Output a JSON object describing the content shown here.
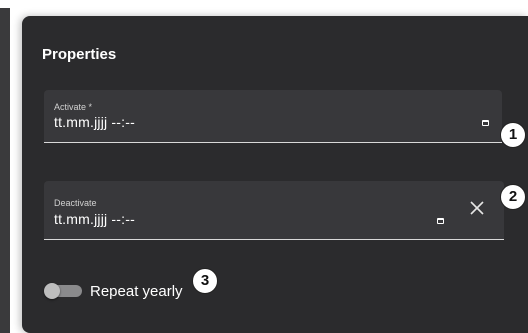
{
  "panel": {
    "title": "Properties"
  },
  "activate": {
    "label": "Activate *",
    "value": "tt.mm.jjjj --:--",
    "icon": "calendar-icon"
  },
  "deactivate": {
    "label": "Deactivate",
    "value": "tt.mm.jjjj --:--",
    "icon": "calendar-icon",
    "clear_icon": "close-icon"
  },
  "repeat": {
    "label": "Repeat yearly",
    "checked": false
  },
  "badges": {
    "one": "1",
    "two": "2",
    "three": "3"
  }
}
